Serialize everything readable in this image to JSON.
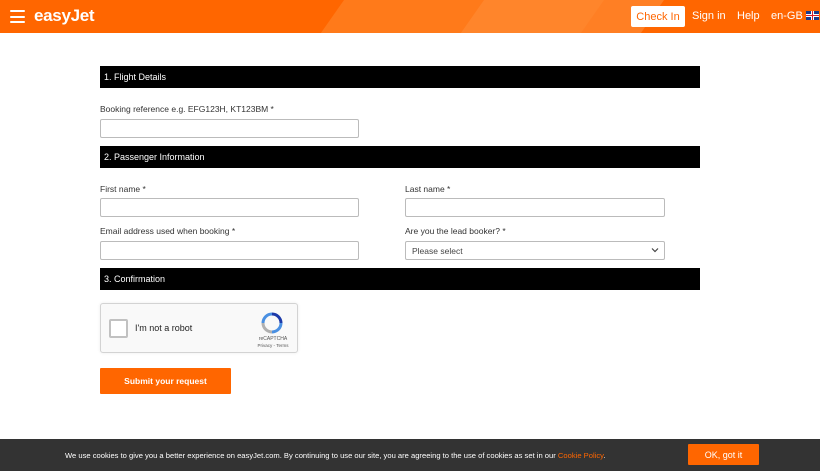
{
  "header": {
    "logo": "easyJet",
    "checkin_label": "Check In",
    "signin_label": "Sign in",
    "help_label": "Help",
    "language_label": "en-GB",
    "language_flag": "uk-flag-icon",
    "brand_color": "#ff6600"
  },
  "form": {
    "section1_title": "1. Flight Details",
    "booking_ref_label": "Booking reference e.g. EFG123H, KT123BM *",
    "booking_ref_value": "",
    "section2_title": "2. Passenger Information",
    "first_name_label": "First name *",
    "first_name_value": "",
    "last_name_label": "Last name *",
    "last_name_value": "",
    "email_label": "Email address used when booking *",
    "email_value": "",
    "lead_booker_label": "Are you the lead booker? *",
    "lead_booker_selected": "Please select",
    "section3_title": "3. Confirmation",
    "submit_label": "Submit your request"
  },
  "captcha": {
    "label": "I'm not a robot",
    "brand": "reCAPTCHA",
    "terms": "Privacy - Terms"
  },
  "cookie_bar": {
    "text": "We use cookies to give you a better experience on easyJet.com. By continuing to use our site, you are agreeing to the use of cookies as set in our",
    "link_label": "Cookie Policy",
    "ok_label": "OK, got it"
  }
}
